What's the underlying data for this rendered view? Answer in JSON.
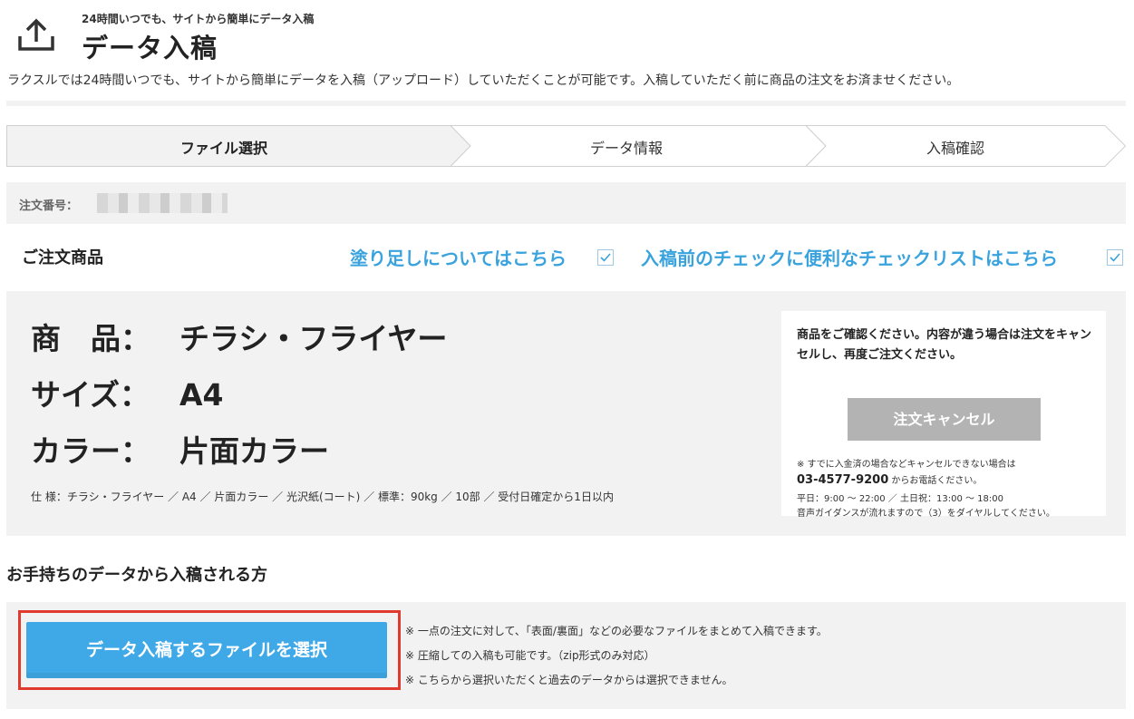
{
  "header": {
    "subtitle": "24時間いつでも、サイトから簡単にデータ入稿",
    "title": "データ入稿",
    "description": "ラクスルでは24時間いつでも、サイトから簡単にデータを入稿（アップロード）していただくことが可能です。入稿していただく前に商品の注文をお済ませください。",
    "icon": "upload-icon"
  },
  "steps": [
    {
      "label": "ファイル選択",
      "active": true
    },
    {
      "label": "データ情報",
      "active": false
    },
    {
      "label": "入稿確認",
      "active": false
    }
  ],
  "order": {
    "label": "注文番号："
  },
  "product_section": {
    "heading": "ご注文商品",
    "link_bleed": "塗り足しについてはこちら",
    "link_checklist": "入稿前のチェックに便利なチェックリストはこちら"
  },
  "product": {
    "product_key": "商　品：",
    "product_value": "チラシ・フライヤー",
    "size_key": "サイズ：",
    "size_value": "A4",
    "color_key": "カラー：",
    "color_value": "片面カラー",
    "detail": "仕 様：チラシ・フライヤー ／ A4 ／ 片面カラー ／ 光沢紙(コート) ／ 標準：90kg ／ 10部 ／ 受付日確定から1日以内"
  },
  "cancel": {
    "message": "商品をご確認ください。内容が違う場合は注文をキャンセルし、再度ご注文ください。",
    "button": "注文キャンセル",
    "note": "※ すでに入金済の場合などキャンセルできない場合は",
    "phone": "03-4577-9200",
    "phone_suffix": " からお電話ください。",
    "hours": "平日：9:00 〜 22:00 ／ 土日祝：13:00 〜 18:00",
    "guide": "音声ガイダンスが流れますので（3）をダイヤルしてください。"
  },
  "upload": {
    "heading": "お手持ちのデータから入稿される方",
    "button": "データ入稿するファイルを選択",
    "notes": [
      "※ 一点の注文に対して、「表面/裏面」などの必要なファイルをまとめて入稿できます。",
      "※ 圧縮しての入稿も可能です。（zip形式のみ対応）",
      "※ こちらから選択いただくと過去のデータからは選択できません。"
    ]
  },
  "colors": {
    "link": "#3aa3dd",
    "primary_button": "#3fa9e8",
    "cancel_button": "#b3b3b3",
    "highlight": "#e03a2e",
    "panel_bg": "#f2f2f2"
  }
}
